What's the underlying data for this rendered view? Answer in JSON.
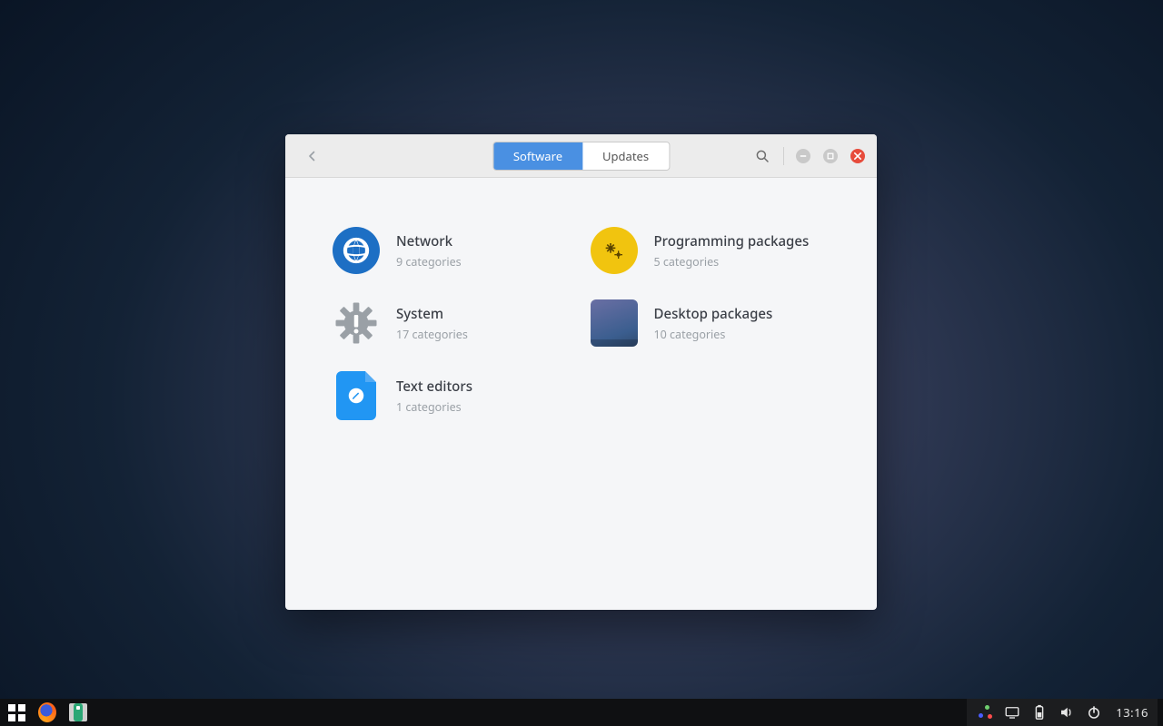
{
  "window": {
    "tabs": {
      "software": "Software",
      "updates": "Updates"
    },
    "categories": [
      {
        "key": "network",
        "title": "Network",
        "sub": "9 categories"
      },
      {
        "key": "programming",
        "title": "Programming packages",
        "sub": "5 categories"
      },
      {
        "key": "system",
        "title": "System",
        "sub": "17 categories"
      },
      {
        "key": "desktop",
        "title": "Desktop packages",
        "sub": "10 categories"
      },
      {
        "key": "text",
        "title": "Text editors",
        "sub": "1 categories"
      }
    ]
  },
  "taskbar": {
    "clock": "13:16"
  }
}
